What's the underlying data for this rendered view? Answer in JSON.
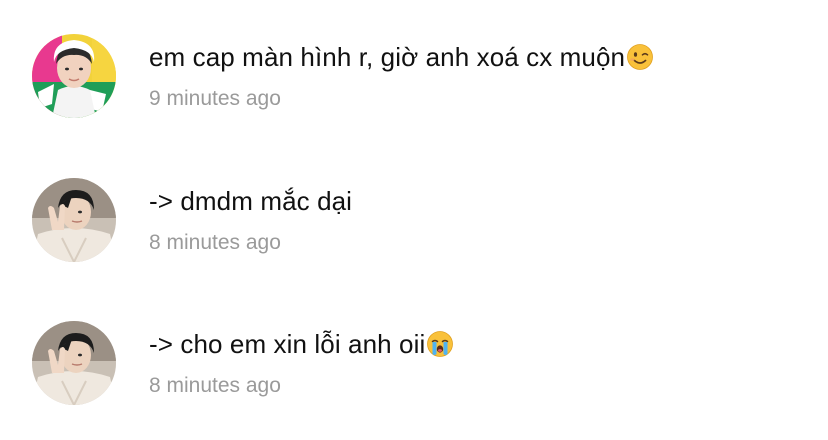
{
  "comments": [
    {
      "avatar_icon": "user-avatar-green-yellow",
      "text": "em cap màn hình r, giờ anh xoá cx muộn",
      "emoji_icon": "winking-face-emoji",
      "time": "9 minutes ago"
    },
    {
      "avatar_icon": "user-avatar-peace-sign",
      "text": "-> dmdm mắc dại",
      "time": "8 minutes ago"
    },
    {
      "avatar_icon": "user-avatar-peace-sign",
      "text": "-> cho em xin lỗi anh oii",
      "emoji_icon": "loudly-crying-face-emoji",
      "time": "8 minutes ago"
    }
  ],
  "colors": {
    "text": "#111111",
    "timestamp": "#9a9a9a",
    "background": "#ffffff"
  }
}
